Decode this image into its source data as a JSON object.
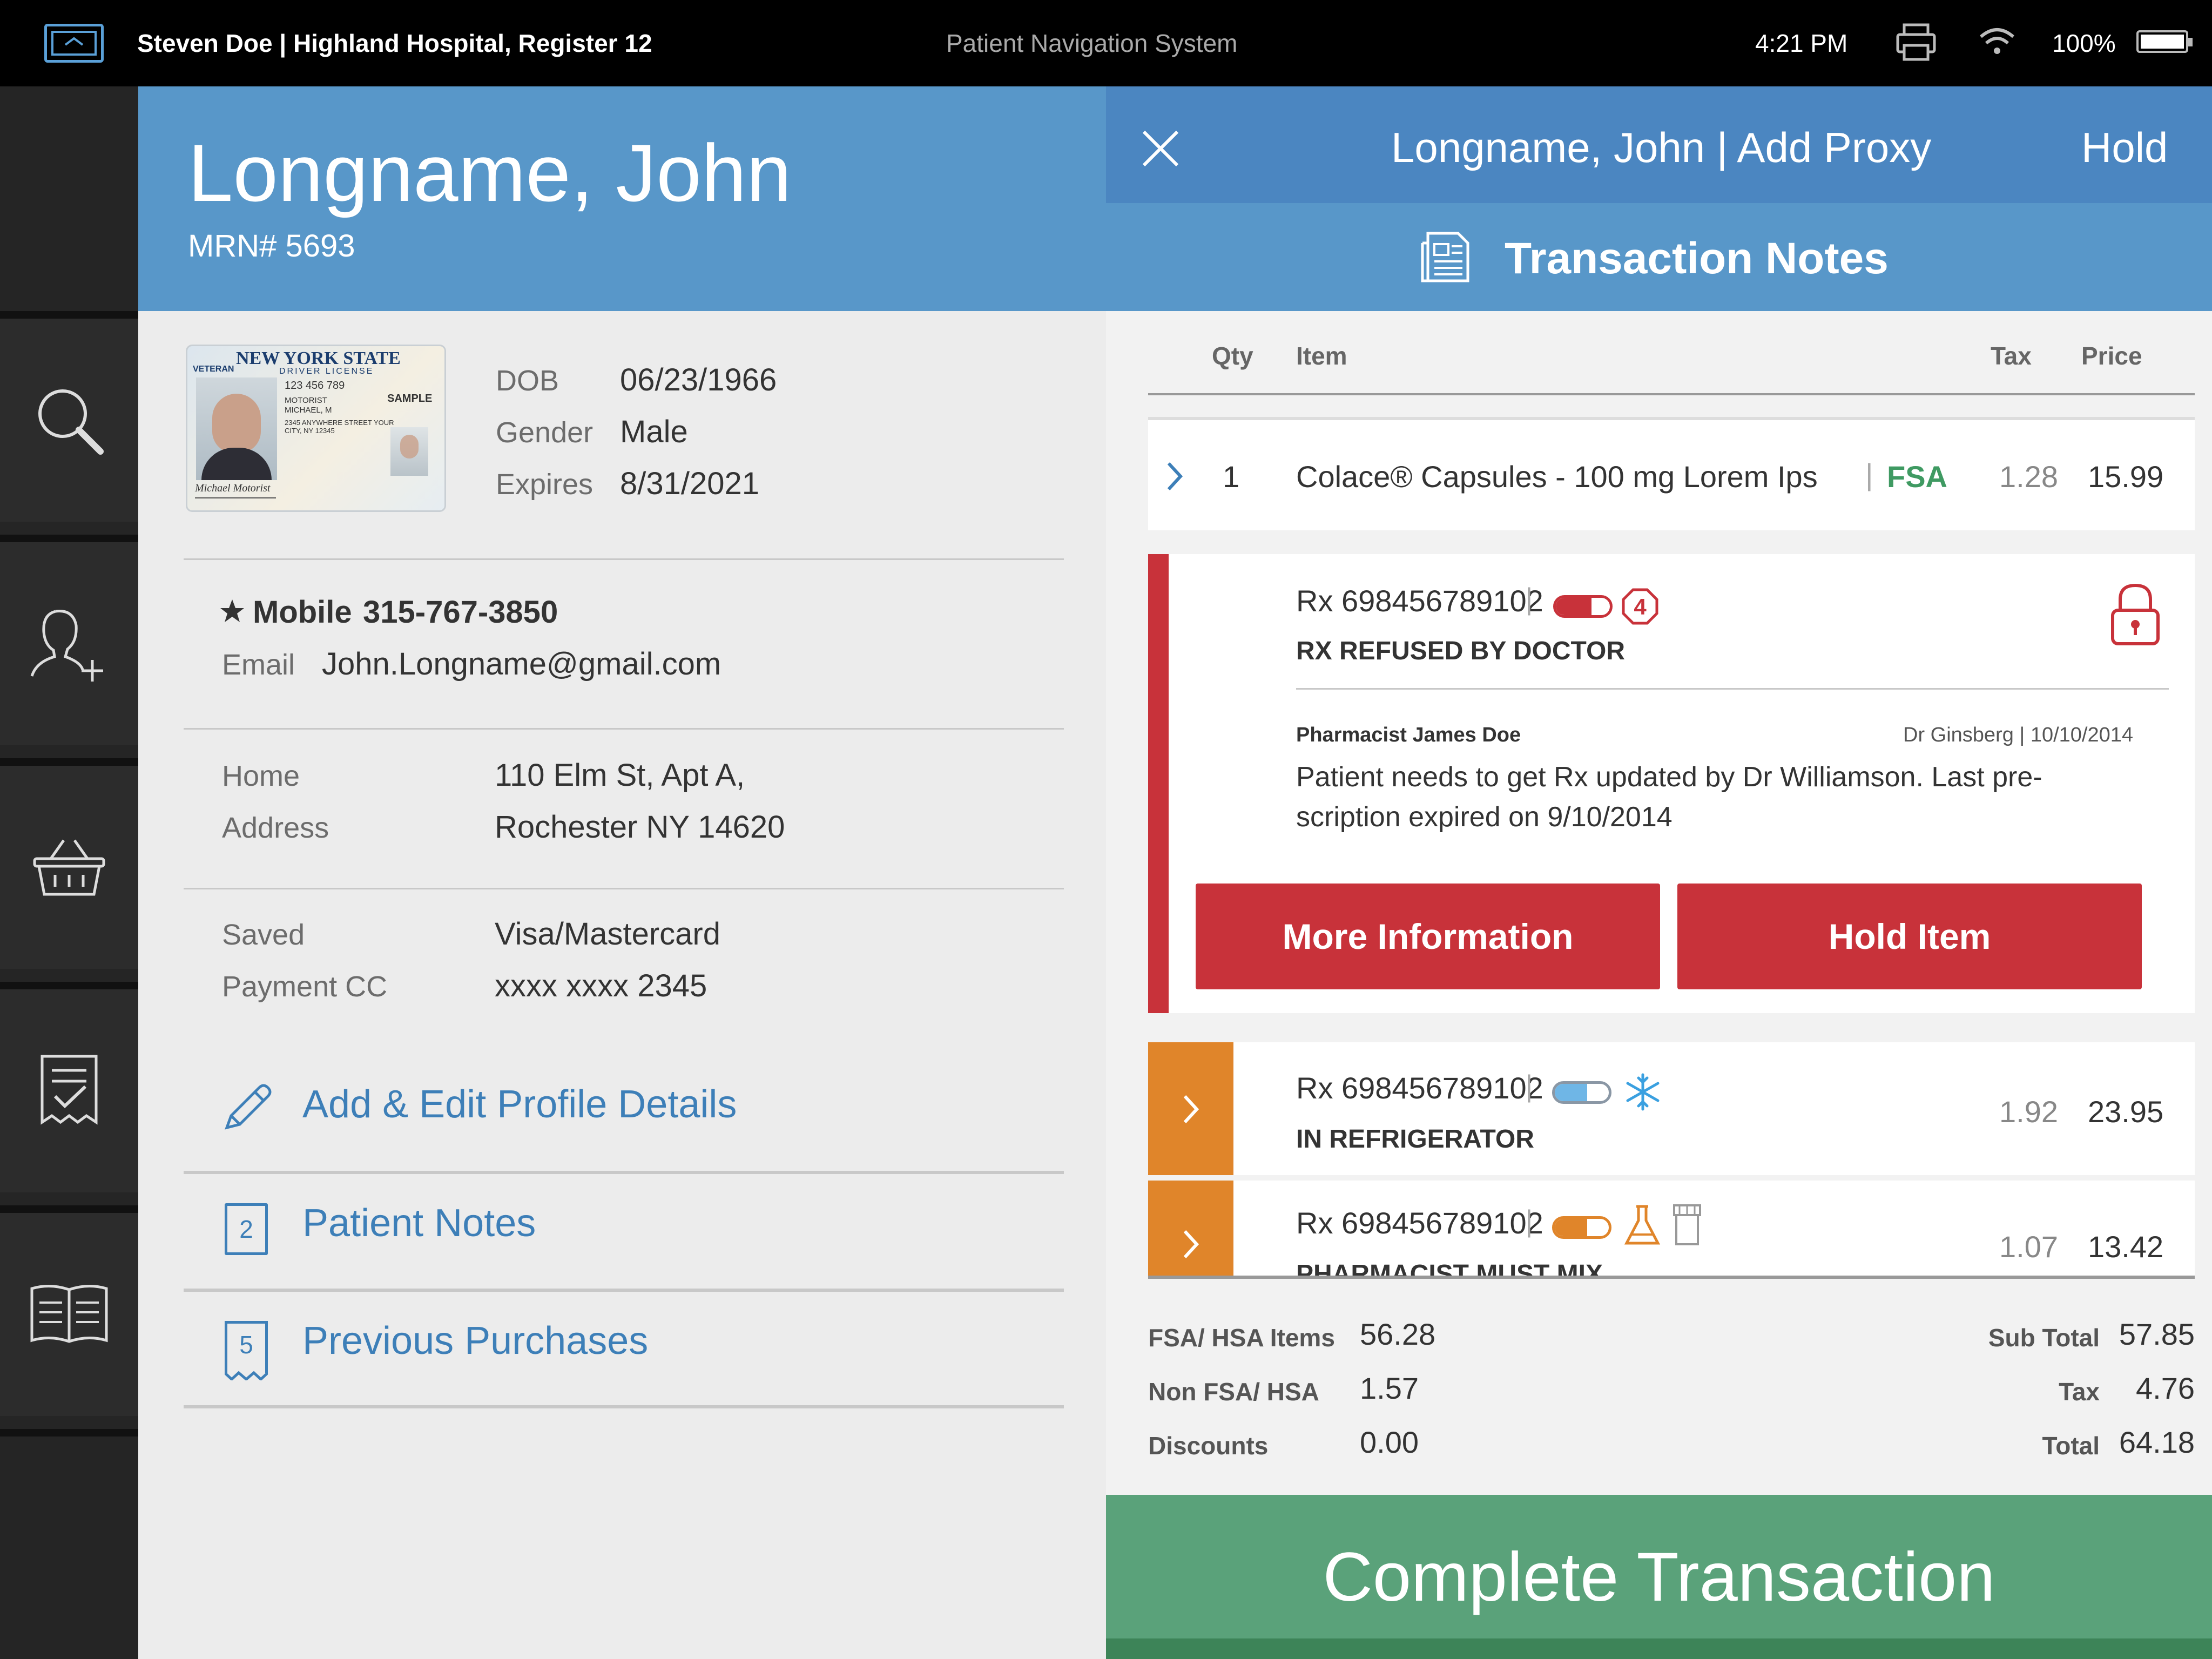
{
  "status_bar": {
    "user_location": "Steven Doe | Highland Hospital, Register 12",
    "app_title": "Patient Navigation System",
    "time": "4:21 PM",
    "battery": "100%"
  },
  "sidebar": {
    "items": [
      {
        "icon": "search-icon"
      },
      {
        "icon": "add-user-icon"
      },
      {
        "icon": "basket-icon"
      },
      {
        "icon": "receipt-icon"
      },
      {
        "icon": "book-icon"
      }
    ]
  },
  "patient": {
    "name": "Longname, John",
    "mrn": "MRN# 5693",
    "license": {
      "state": "NEW YORK STATE",
      "type": "DRIVER LICENSE",
      "veteran": "VETERAN",
      "sample": "SAMPLE",
      "number": "123 456 789",
      "name": "MOTORIST MICHAEL, M",
      "address": "2345 ANYWHERE STREET YOUR CITY, NY 12345"
    },
    "dob_label": "DOB",
    "dob": "06/23/1966",
    "gender_label": "Gender",
    "gender": "Male",
    "expires_label": "Expires",
    "expires": "8/31/2021",
    "mobile_label": "Mobile",
    "mobile": "315-767-3850",
    "email_label": "Email",
    "email": "John.Longname@gmail.com",
    "home_label": "Home",
    "address_label": "Address",
    "address_line1": "110 Elm St, Apt A,",
    "address_line2": "Rochester NY 14620",
    "saved_label": "Saved",
    "payment_label": "Payment CC",
    "card_type": "Visa/Mastercard",
    "card_number": "xxxx xxxx 2345"
  },
  "links": {
    "edit_profile": "Add & Edit Profile Details",
    "patient_notes": "Patient Notes",
    "patient_notes_count": "2",
    "previous_purchases": "Previous Purchases",
    "previous_purchases_count": "5"
  },
  "transaction": {
    "header_title": "Longname, John | Add Proxy",
    "hold": "Hold",
    "notes_title": "Transaction Notes",
    "columns": {
      "qty": "Qty",
      "item": "Item",
      "tax": "Tax",
      "price": "Price"
    },
    "item1": {
      "qty": "1",
      "name": "Colace® Capsules - 100 mg Lorem Ips",
      "badge": "FSA",
      "tax": "1.28",
      "price": "15.99"
    },
    "refused": {
      "rx": "Rx 698456789102",
      "badge_number": "4",
      "status": "RX REFUSED BY DOCTOR",
      "author": "Pharmacist James Doe",
      "doctor_date": "Dr Ginsberg | 10/10/2014",
      "note": "Patient needs to get Rx updated by Dr Williamson. Last pre-scription expired on 9/10/2014",
      "more_info": "More Information",
      "hold_item": "Hold Item"
    },
    "fridge": {
      "rx": "Rx 698456789102",
      "status": "IN REFRIGERATOR",
      "tax": "1.92",
      "price": "23.95"
    },
    "mix": {
      "rx": "Rx 698456789102",
      "status": "PHARMACIST MUST MIX",
      "tax": "1.07",
      "price": "13.42"
    },
    "summary": {
      "fsa_label": "FSA/ HSA Items",
      "fsa": "56.28",
      "non_fsa_label": "Non FSA/ HSA",
      "non_fsa": "1.57",
      "discounts_label": "Discounts",
      "discounts": "0.00",
      "subtotal_label": "Sub Total",
      "subtotal": "57.85",
      "tax_label": "Tax",
      "tax": "4.76",
      "total_label": "Total",
      "total": "64.18"
    },
    "complete": "Complete Transaction"
  },
  "colors": {
    "header_blue": "#5897c9",
    "dark_blue": "#4b86c1",
    "alert_red": "#c8323a",
    "warning_orange": "#e0852a",
    "fsa_green": "#3f9a62",
    "complete_green": "#5aa27a"
  }
}
